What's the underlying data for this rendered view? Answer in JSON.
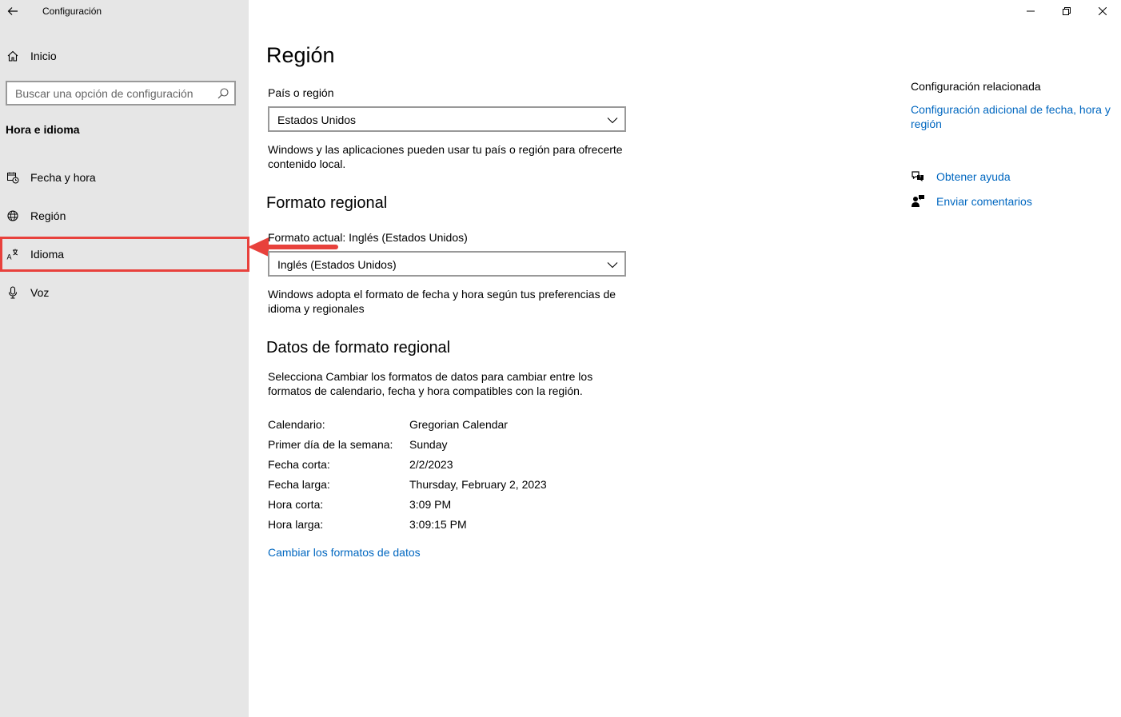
{
  "window": {
    "title": "Configuración",
    "controls": [
      "minimize",
      "maximize",
      "close"
    ]
  },
  "sidebar": {
    "home_label": "Inicio",
    "search_placeholder": "Buscar una opción de configuración",
    "section_title": "Hora e idioma",
    "items": [
      {
        "label": "Fecha y hora",
        "icon": "calendar-clock-icon"
      },
      {
        "label": "Región",
        "icon": "globe-icon"
      },
      {
        "label": "Idioma",
        "icon": "language-icon",
        "highlighted": true
      },
      {
        "label": "Voz",
        "icon": "microphone-icon"
      }
    ]
  },
  "annotation": {
    "color": "#e8413c",
    "target": "Idioma"
  },
  "main": {
    "title": "Región",
    "country": {
      "label": "País o región",
      "value": "Estados Unidos",
      "description": "Windows y las aplicaciones pueden usar tu país o región para ofrecerte contenido local."
    },
    "regional_format": {
      "title": "Formato regional",
      "current_label": "Formato actual: Inglés (Estados Unidos)",
      "value": "Inglés (Estados Unidos)",
      "description": "Windows adopta el formato de fecha y hora según tus preferencias de idioma y regionales"
    },
    "format_data": {
      "title": "Datos de formato regional",
      "description": "Selecciona Cambiar los formatos de datos para cambiar entre los formatos de calendario, fecha y hora compatibles con la región.",
      "rows": [
        {
          "key": "Calendario:",
          "value": "Gregorian Calendar"
        },
        {
          "key": "Primer día de la semana:",
          "value": "Sunday"
        },
        {
          "key": "Fecha corta:",
          "value": "2/2/2023"
        },
        {
          "key": "Fecha larga:",
          "value": "Thursday, February 2, 2023"
        },
        {
          "key": "Hora corta:",
          "value": "3:09 PM"
        },
        {
          "key": "Hora larga:",
          "value": "3:09:15 PM"
        }
      ],
      "change_link": "Cambiar los formatos de datos"
    }
  },
  "related": {
    "title": "Configuración relacionada",
    "link": "Configuración adicional de fecha, hora y región",
    "help_label": "Obtener ayuda",
    "feedback_label": "Enviar comentarios"
  },
  "colors": {
    "sidebar_bg": "#e6e6e6",
    "link": "#0067c0",
    "highlight": "#e8413c"
  }
}
